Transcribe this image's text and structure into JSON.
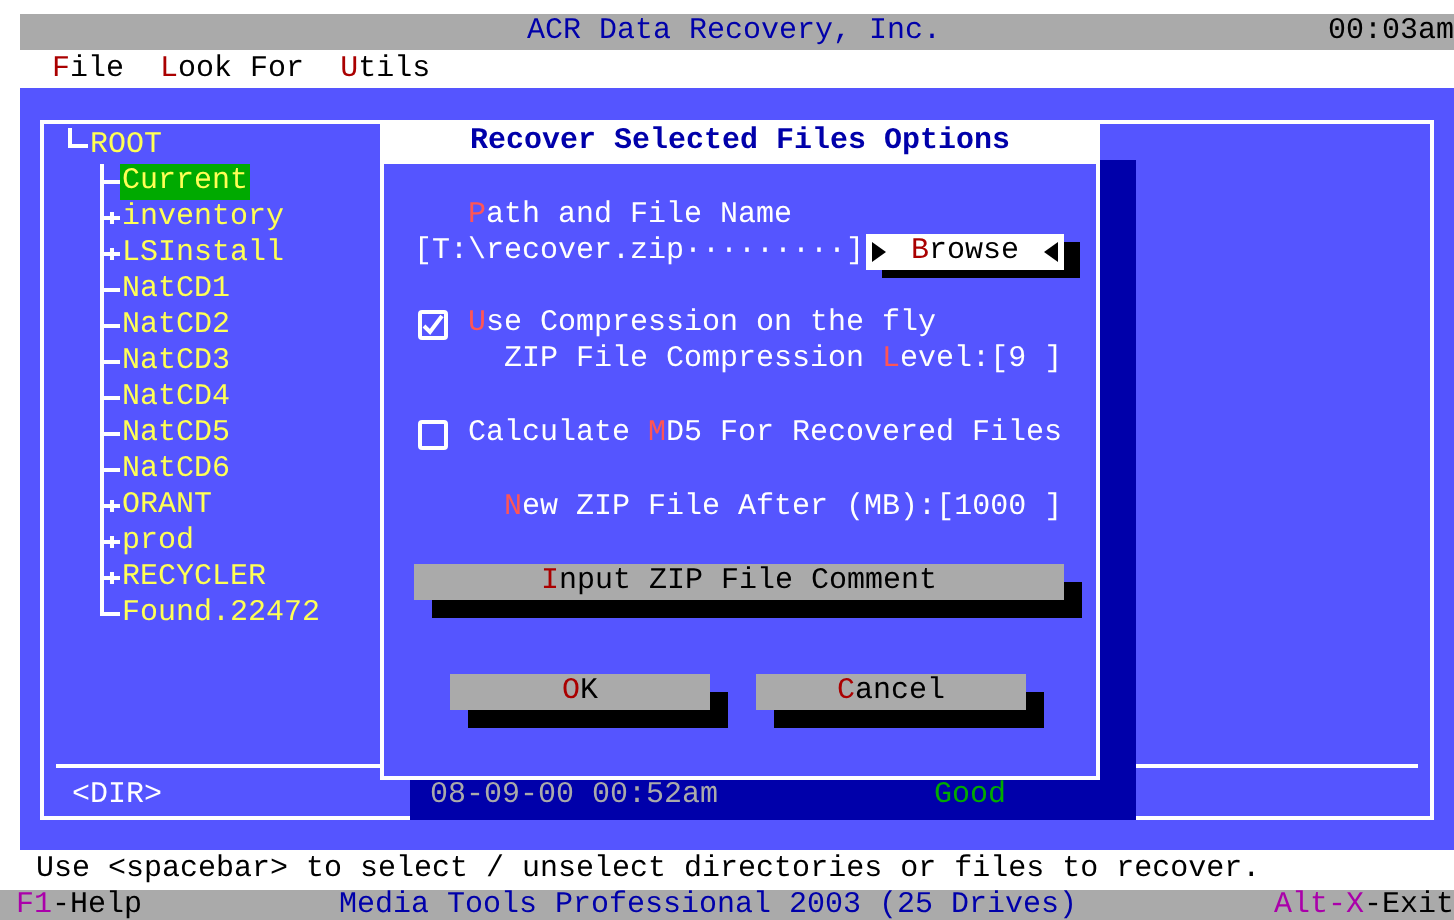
{
  "title_bar": {
    "title": "ACR Data Recovery, Inc.",
    "time": "00:03am"
  },
  "menu": [
    {
      "hotkey": "F",
      "rest": "ile"
    },
    {
      "hotkey": "L",
      "rest": "ook For"
    },
    {
      "hotkey": "U",
      "rest": "tils"
    }
  ],
  "tree": {
    "label": "ROOT",
    "selected": false,
    "children": [
      {
        "label": "Current",
        "selected": true,
        "collapsed": false
      },
      {
        "label": "inventory",
        "selected": false,
        "collapsed": true
      },
      {
        "label": "LSInstall",
        "selected": false,
        "collapsed": true
      },
      {
        "label": "NatCD1",
        "selected": false,
        "collapsed": false
      },
      {
        "label": "NatCD2",
        "selected": false,
        "collapsed": false
      },
      {
        "label": "NatCD3",
        "selected": false,
        "collapsed": false
      },
      {
        "label": "NatCD4",
        "selected": false,
        "collapsed": false
      },
      {
        "label": "NatCD5",
        "selected": false,
        "collapsed": false
      },
      {
        "label": "NatCD6",
        "selected": false,
        "collapsed": false
      },
      {
        "label": "ORANT",
        "selected": false,
        "collapsed": true
      },
      {
        "label": "prod",
        "selected": false,
        "collapsed": true
      },
      {
        "label": "RECYCLER",
        "selected": false,
        "collapsed": true
      },
      {
        "label": "Found.22472",
        "selected": false,
        "collapsed": false
      }
    ]
  },
  "info_row": {
    "type": "<DIR>",
    "date": "08-09-00 00:52am",
    "status": "Good"
  },
  "dialog": {
    "title": "Recover Selected Files Options",
    "path_label": {
      "hotkey": "P",
      "after": "ath and File Name"
    },
    "path_value": "[T:\\recover.zip·········]",
    "browse_button": {
      "hotkey": "B",
      "after": "rowse"
    },
    "compression": {
      "checked": true,
      "label": {
        "hotkey": "U",
        "after": "se Compression on the fly"
      }
    },
    "compression_level": {
      "label": {
        "before": "ZIP File Compression ",
        "hotkey": "L",
        "after": "evel:"
      },
      "value": "[9 ]"
    },
    "md5": {
      "checked": false,
      "label": {
        "before": "Calculate ",
        "hotkey": "M",
        "after": "D5 For Recovered Files"
      }
    },
    "new_zip": {
      "label": {
        "hotkey": "N",
        "after": "ew ZIP File After (MB):"
      },
      "value": "[1000 ]"
    },
    "comment_button": {
      "hotkey": "I",
      "after": "nput ZIP File Comment"
    },
    "ok_button": {
      "hotkey": "O",
      "after": "K"
    },
    "cancel_button": {
      "hotkey": "C",
      "after": "ancel"
    }
  },
  "status_line": "Use <spacebar> to select / unselect directories or files to recover.",
  "bottom_bar": {
    "help": {
      "key": "F1",
      "rest": "-Help"
    },
    "product": "Media Tools Professional 2003 (25 Drives)",
    "exit": {
      "key": "Alt-X",
      "rest": "-Exit"
    }
  }
}
